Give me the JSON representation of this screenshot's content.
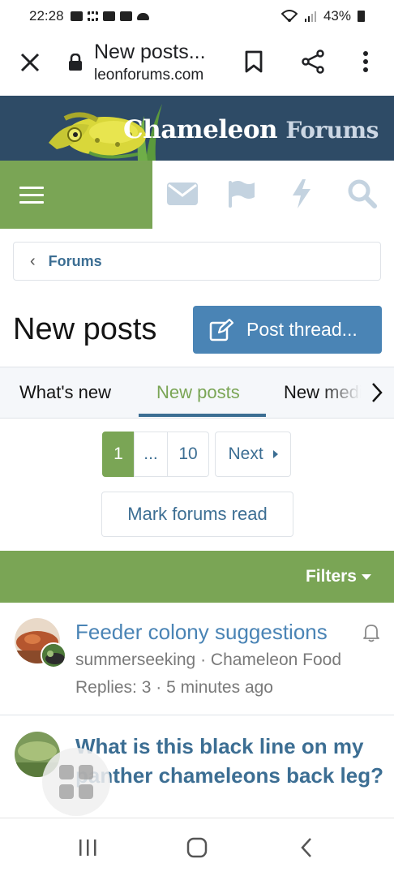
{
  "status_bar": {
    "time": "22:28",
    "battery": "43%"
  },
  "browser": {
    "tab_title": "New posts...",
    "url": "leonforums.com"
  },
  "site": {
    "logo_main": "Chameleon",
    "logo_secondary": "Forums"
  },
  "breadcrumb": {
    "item": "Forums"
  },
  "page": {
    "title": "New posts",
    "post_thread_label": "Post thread..."
  },
  "tabs": [
    {
      "label": "What's new"
    },
    {
      "label": "New posts"
    },
    {
      "label": "New media"
    }
  ],
  "pagination": {
    "current": "1",
    "ellipsis": "...",
    "last": "10",
    "next": "Next"
  },
  "mark_forums_read": "Mark forums read",
  "filters_label": "Filters",
  "threads": [
    {
      "title": "Feeder colony suggestions",
      "author": "summerseeking",
      "forum": "Chameleon Food",
      "replies": "Replies: 3",
      "time": "5 minutes ago",
      "unread": false
    },
    {
      "title": "What is this black line on my panther chameleons back leg?",
      "unread": true
    }
  ],
  "colors": {
    "header_bg": "#2e4b66",
    "accent_green": "#7aa555",
    "primary_blue": "#4a84b5",
    "link_blue": "#3c6e93"
  }
}
